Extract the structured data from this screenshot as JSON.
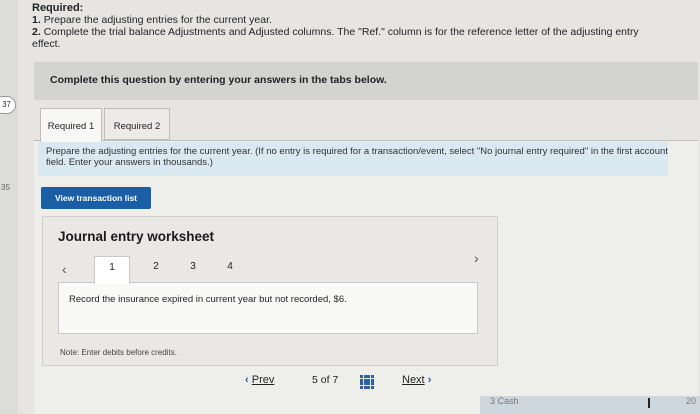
{
  "requirements": {
    "heading": "Required:",
    "items": [
      {
        "num": "1.",
        "text": "Prepare the adjusting entries for the current year."
      },
      {
        "num": "2.",
        "text": "Complete the trial balance Adjustments and Adjusted columns. The \"Ref.\" column is for the reference letter of the adjusting entry"
      },
      {
        "num": "",
        "text": "effect."
      }
    ]
  },
  "instruction_bar": "Complete this question by entering your answers in the tabs below.",
  "tabs": [
    {
      "label": "Required 1",
      "active": true
    },
    {
      "label": "Required 2",
      "active": false
    }
  ],
  "prepare_text": "Prepare the adjusting entries for the current year. (If no entry is required for a transaction/event, select \"No journal entry required\" in the first account field. Enter your answers in thousands.)",
  "view_button": "View transaction list",
  "worksheet": {
    "title": "Journal entry worksheet",
    "pages": [
      "1",
      "2",
      "3",
      "4"
    ],
    "active_page": "1",
    "description": "Record the insurance expired in current year but not recorded, $6.",
    "note": "Note: Enter debits before credits."
  },
  "footer": {
    "prev": "Prev",
    "page_current": "5",
    "page_of": "of",
    "page_total": "7",
    "next": "Next"
  },
  "edge": {
    "badge": "37",
    "num": "35"
  },
  "bottom_fragments": {
    "left": "3   Cash",
    "right": "20"
  },
  "colors": {
    "primary_button": "#1a5fa6",
    "prepare_box": "#d9e8f1",
    "instruction_bar": "#d3d4d2"
  },
  "icons": [
    "chevron-left-icon",
    "chevron-right-icon",
    "grid-icon"
  ]
}
